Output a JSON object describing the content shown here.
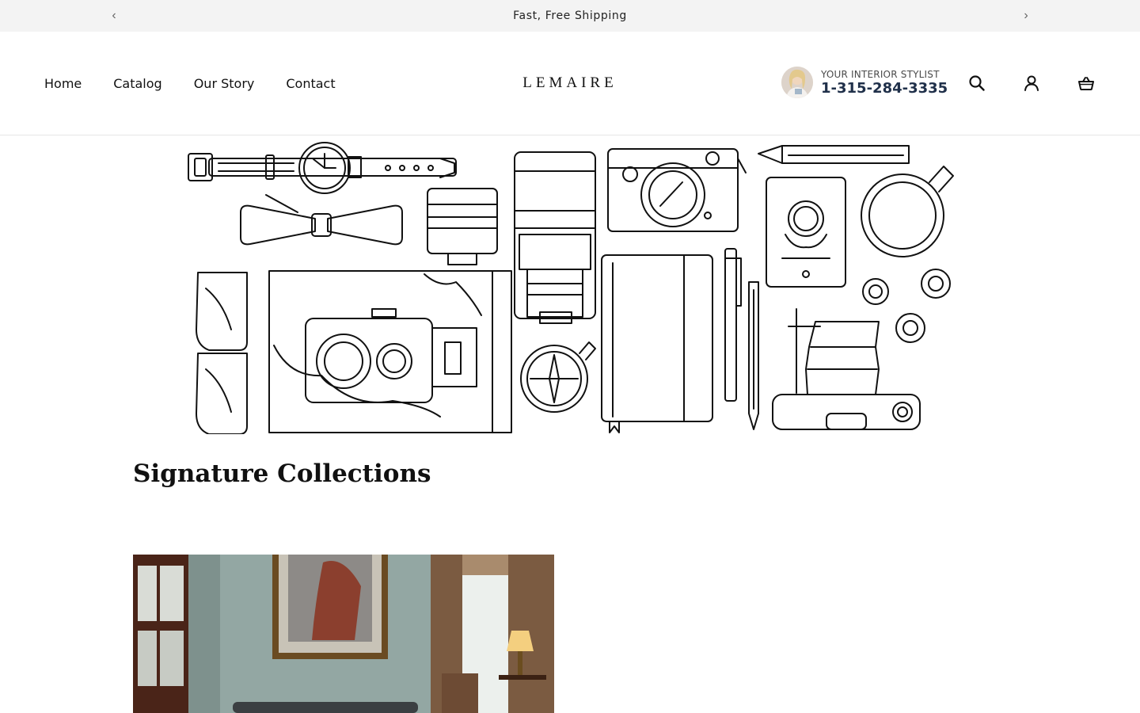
{
  "announcement": {
    "text": "Fast, Free Shipping",
    "prev_label": "‹",
    "next_label": "›"
  },
  "header": {
    "nav": [
      {
        "label": "Home"
      },
      {
        "label": "Catalog"
      },
      {
        "label": "Our Story"
      },
      {
        "label": "Contact"
      }
    ],
    "logo": "LEMAIRE",
    "stylist": {
      "label": "YOUR INTERIOR STYLIST",
      "phone": "1-315-284-3335"
    },
    "icons": [
      "search-icon",
      "account-icon",
      "cart-icon"
    ]
  },
  "main": {
    "section_title": "Signature Collections"
  },
  "colors": {
    "announcement_bg": "#f3f3f3",
    "phone": "#20304a",
    "text": "#111111"
  }
}
